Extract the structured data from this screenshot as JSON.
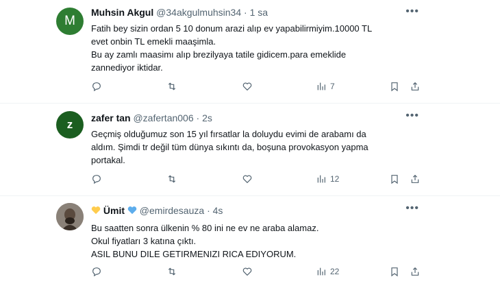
{
  "tweets": [
    {
      "avatar_letter": "M",
      "avatar_color": "#2e7d32",
      "name": "Muhsin Akgul",
      "handle": "@34akgulmuhsin34",
      "separator": "·",
      "time": "1 sa",
      "lines": [
        "Fatih bey sizin ordan 5 10 donum arazi alıp ev yapabilirmiyim.10000 TL",
        "evet onbin TL emekli maaşimla.",
        "Bu ay zamlı maasimı alıp brezilyaya  tatile gidicem.para emeklide",
        "zannediyor iktidar."
      ],
      "views": "7"
    },
    {
      "avatar_letter": "Z",
      "avatar_color": "#1b5e20",
      "name": "zafer tan",
      "handle": "@zafertan006",
      "separator": "·",
      "time": "2s",
      "lines": [
        "Geçmiş olduğumuz son 15 yıl fırsatlar la doluydu evimi de arabamı da",
        "aldım. Şimdi tr değil tüm dünya sıkıntı da, boşuna provokasyon yapma",
        "portakal."
      ],
      "views": "12"
    },
    {
      "name": "Ümit",
      "handle": "@emirdesauza",
      "separator": "·",
      "time": "4s",
      "lines": [
        "Bu saatten sonra ülkenin % 80 ini ne ev ne araba alamaz.",
        "Okul fiyatları 3 katına çıktı.",
        "ASIL BUNU DILE GETIRMENIZI RICA EDIYORUM."
      ],
      "views": "22"
    }
  ],
  "colors": {
    "text": "#0f1419",
    "secondary": "#536471",
    "divider": "#eff3f4",
    "yellow_heart": "#ffcc4d",
    "blue_heart": "#5dadec"
  },
  "icons": [
    "reply-icon",
    "retweet-icon",
    "like-icon",
    "views-icon",
    "bookmark-icon",
    "share-icon",
    "more-icon"
  ]
}
